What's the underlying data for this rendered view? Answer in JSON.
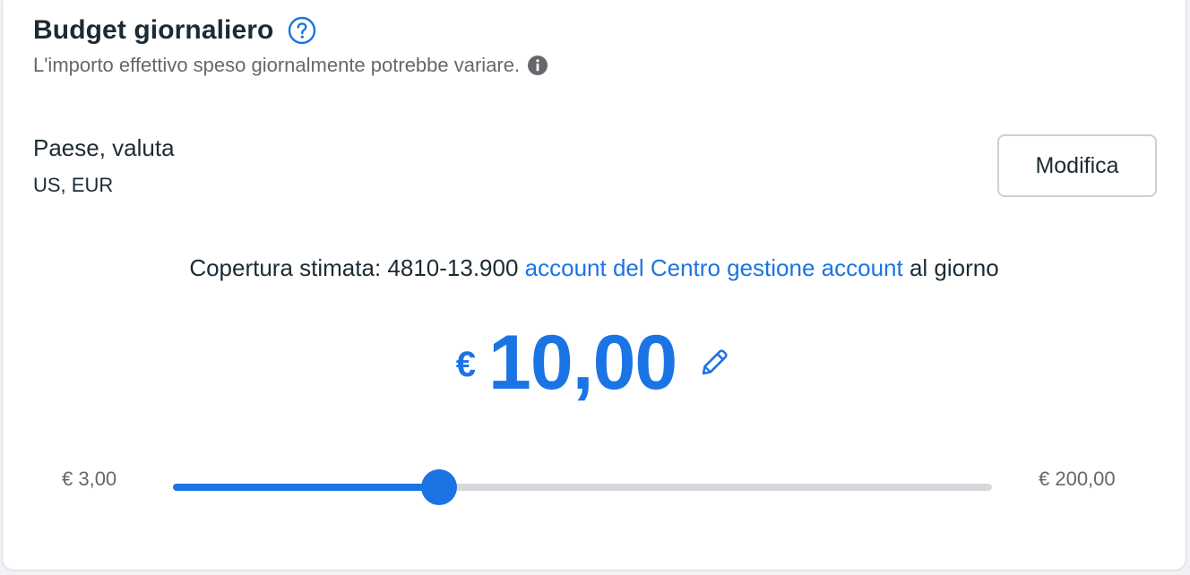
{
  "header": {
    "title": "Budget giornaliero",
    "subtitle": "L'importo effettivo speso giornalmente potrebbe variare."
  },
  "country": {
    "label": "Paese, valuta",
    "value": "US, EUR",
    "edit_label": "Modifica"
  },
  "reach": {
    "prefix": "Copertura stimata: 4810-13.900 ",
    "link": "account del Centro gestione account",
    "suffix": " al giorno"
  },
  "budget": {
    "currency": "€",
    "amount": "10,00"
  },
  "slider": {
    "min_label": "€ 3,00",
    "max_label": "€ 200,00",
    "position_fraction": 0.325
  },
  "colors": {
    "accent": "#1b74e4",
    "text": "#1c2b33",
    "muted": "#65676b"
  },
  "icons": {
    "help": "question-circle-icon",
    "info": "info-circle-icon",
    "edit": "pencil-icon"
  }
}
